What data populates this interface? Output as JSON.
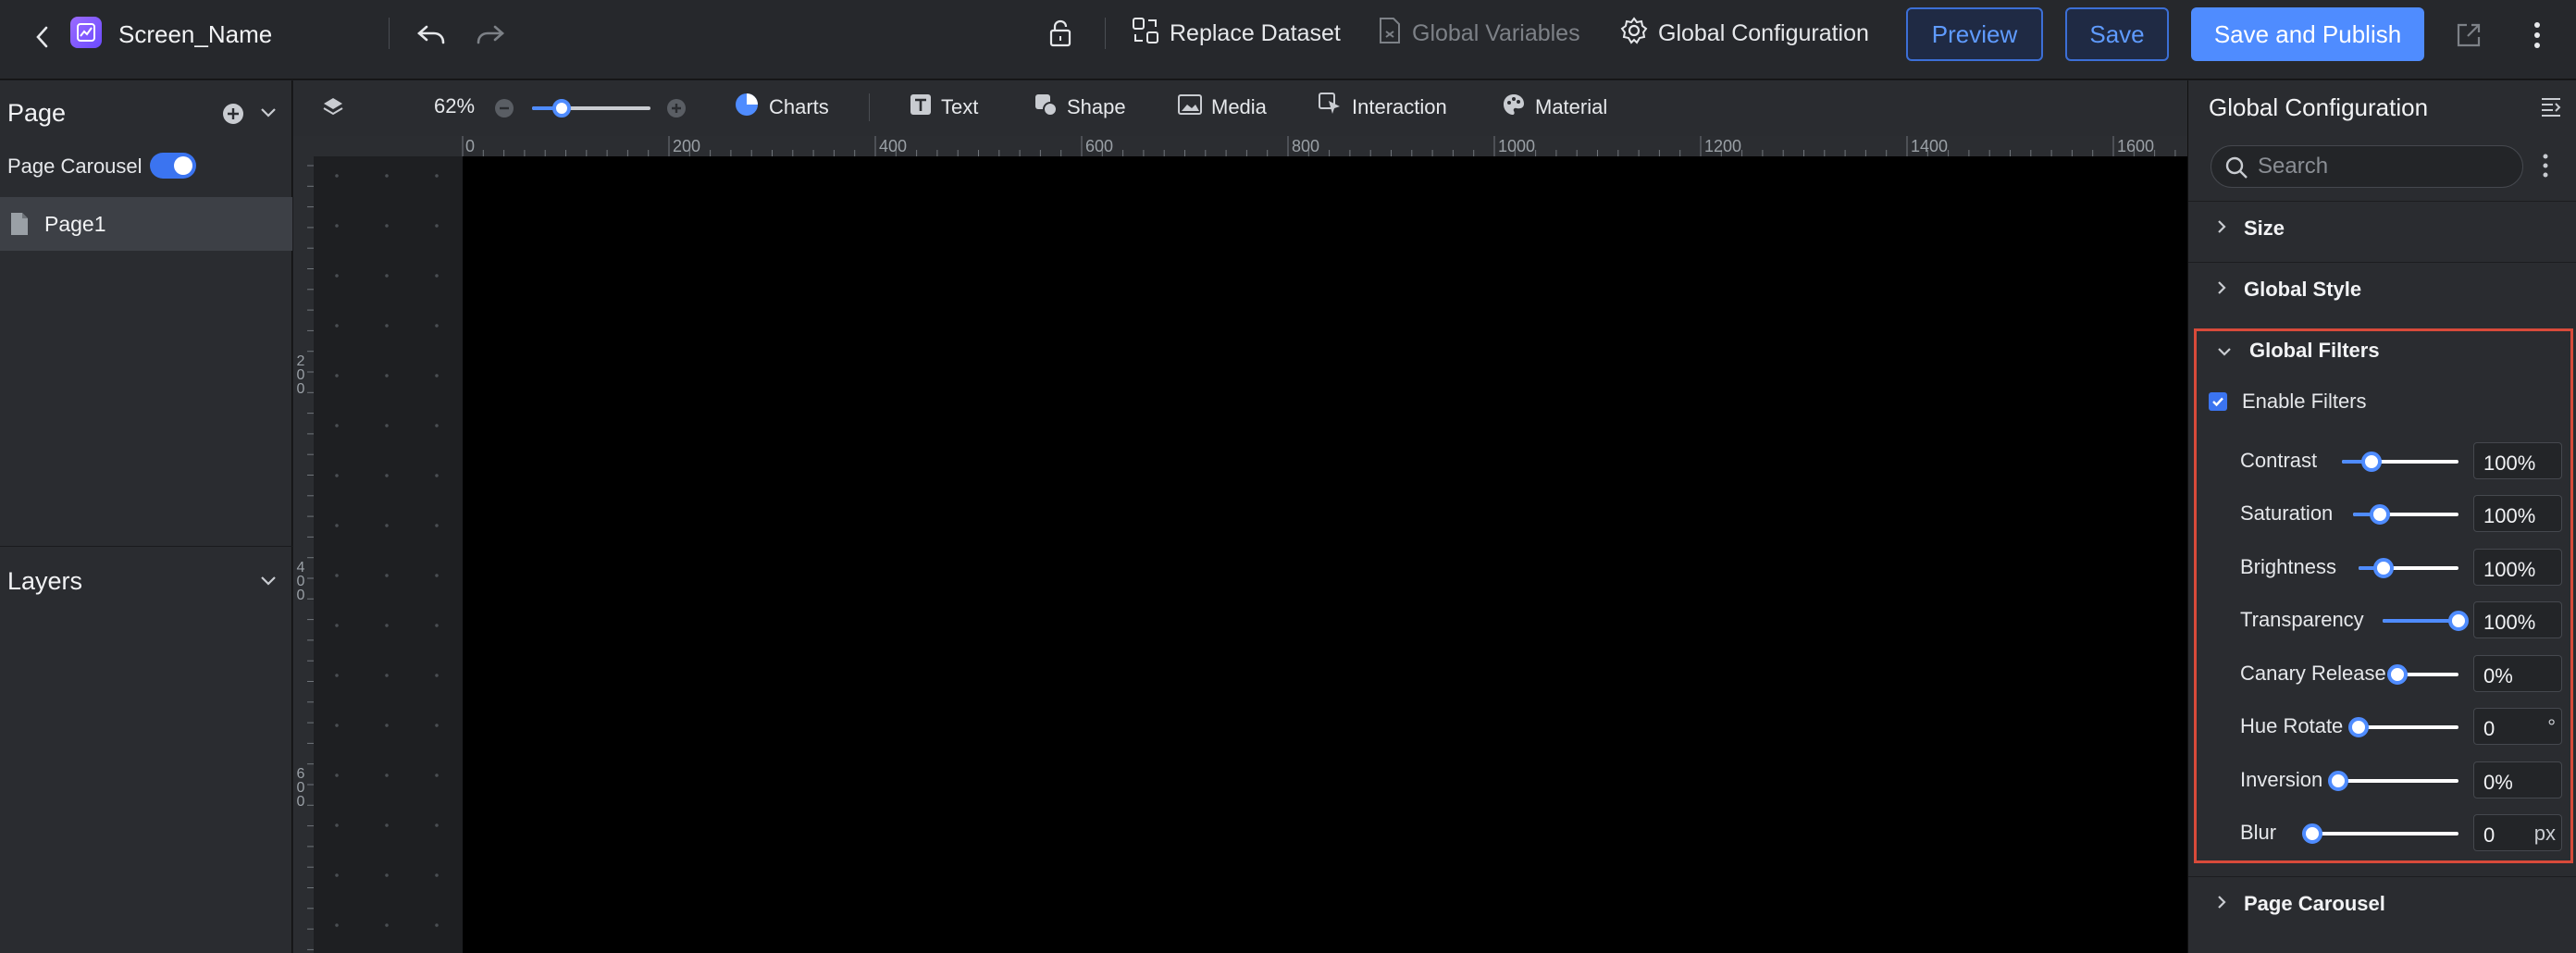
{
  "header": {
    "screen_name": "Screen_Name",
    "replace_dataset": "Replace Dataset",
    "global_variables": "Global Variables",
    "global_configuration": "Global Configuration",
    "preview": "Preview",
    "save": "Save",
    "save_and_publish": "Save and Publish"
  },
  "left_panel": {
    "page_title": "Page",
    "page_carousel_label": "Page Carousel",
    "page_carousel_enabled": true,
    "pages": [
      "Page1"
    ],
    "layers_title": "Layers"
  },
  "canvas_toolbar": {
    "zoom": "62%",
    "zoom_value": 0.62,
    "items": [
      "Charts",
      "Text",
      "Shape",
      "Media",
      "Interaction",
      "Material"
    ]
  },
  "rulers": {
    "horizontal": [
      "0",
      "200",
      "400",
      "600",
      "800",
      "1000",
      "1200",
      "1400",
      "1600"
    ],
    "vertical": [
      [
        "2",
        "0",
        "0"
      ],
      [
        "4",
        "0",
        "0"
      ],
      [
        "6",
        "0",
        "0"
      ]
    ]
  },
  "right_panel": {
    "title": "Global Configuration",
    "search_placeholder": "Search",
    "sections": {
      "size": "Size",
      "global_style": "Global Style",
      "global_filters": "Global Filters",
      "page_carousel": "Page Carousel"
    },
    "enable_filters_label": "Enable Filters",
    "enable_filters": true,
    "filters": [
      {
        "label": "Contrast",
        "value": "100%",
        "unit": "",
        "level": 0.25
      },
      {
        "label": "Saturation",
        "value": "100%",
        "unit": "",
        "level": 0.25
      },
      {
        "label": "Brightness",
        "value": "100%",
        "unit": "",
        "level": 0.25
      },
      {
        "label": "Transparency",
        "value": "100%",
        "unit": "",
        "level": 1.0
      },
      {
        "label": "Canary Release",
        "value": "0%",
        "unit": "",
        "level": 0.0
      },
      {
        "label": "Hue Rotate",
        "value": "0",
        "unit": "°",
        "level": 0.0
      },
      {
        "label": "Inversion",
        "value": "0%",
        "unit": "",
        "level": 0.0
      },
      {
        "label": "Blur",
        "value": "0",
        "unit": "px",
        "level": 0.0
      }
    ]
  },
  "colors": {
    "accent": "#4f8cff",
    "highlight_border": "#d84a3a",
    "canvas": "#000000"
  }
}
